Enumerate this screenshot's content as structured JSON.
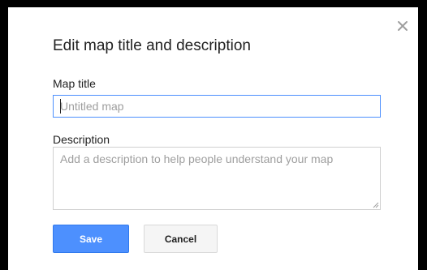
{
  "dialog": {
    "title": "Edit map title and description",
    "close_icon": "close-icon",
    "map_title": {
      "label": "Map title",
      "value": "",
      "placeholder": "Untitled map"
    },
    "description": {
      "label": "Description",
      "value": "",
      "placeholder": "Add a description to help people understand your map"
    },
    "buttons": {
      "save_label": "Save",
      "cancel_label": "Cancel"
    }
  },
  "colors": {
    "primary": "#4d90fe",
    "focus_border": "#4d90fe",
    "backdrop": "#000000"
  }
}
